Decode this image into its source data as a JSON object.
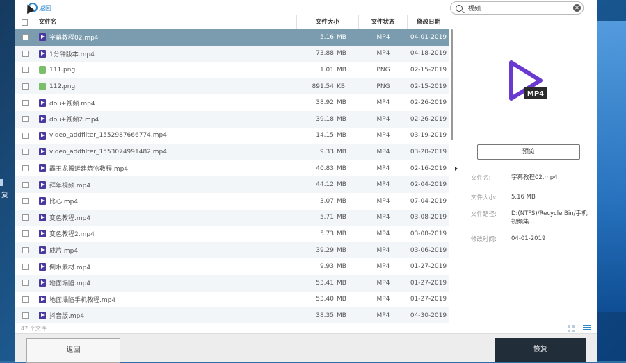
{
  "desktop": {
    "left_label": "复"
  },
  "header": {
    "back_link": "返回",
    "search": {
      "value": "视频"
    }
  },
  "table": {
    "columns": {
      "name": "文件名",
      "size": "文件大小",
      "status": "文件状态",
      "date": "修改日期"
    },
    "rows": [
      {
        "name": "字幕教程02.mp4",
        "size": "5.16",
        "unit": "MB",
        "status": "MP4",
        "date": "04-01-2019",
        "type": "mp4",
        "selected": true
      },
      {
        "name": "1分钟版本.mp4",
        "size": "73.88",
        "unit": "MB",
        "status": "MP4",
        "date": "04-18-2019",
        "type": "mp4"
      },
      {
        "name": "111.png",
        "size": "1.01",
        "unit": "MB",
        "status": "PNG",
        "date": "02-15-2019",
        "type": "png"
      },
      {
        "name": "112.png",
        "size": "891.54",
        "unit": "KB",
        "status": "PNG",
        "date": "02-15-2019",
        "type": "png"
      },
      {
        "name": "dou+视频.mp4",
        "size": "38.92",
        "unit": "MB",
        "status": "MP4",
        "date": "02-26-2019",
        "type": "mp4"
      },
      {
        "name": "dou+视频2.mp4",
        "size": "39.18",
        "unit": "MB",
        "status": "MP4",
        "date": "02-26-2019",
        "type": "mp4"
      },
      {
        "name": "video_addfilter_1552987666774.mp4",
        "size": "14.15",
        "unit": "MB",
        "status": "MP4",
        "date": "03-19-2019",
        "type": "mp4"
      },
      {
        "name": "video_addfilter_1553074991482.mp4",
        "size": "9.33",
        "unit": "MB",
        "status": "MP4",
        "date": "03-20-2019",
        "type": "mp4"
      },
      {
        "name": "霸王龙搬运建筑物教程.mp4",
        "size": "40.83",
        "unit": "MB",
        "status": "MP4",
        "date": "02-16-2019",
        "type": "mp4"
      },
      {
        "name": "拜年视频.mp4",
        "size": "44.12",
        "unit": "MB",
        "status": "MP4",
        "date": "02-04-2019",
        "type": "mp4"
      },
      {
        "name": "比心.mp4",
        "size": "3.07",
        "unit": "MB",
        "status": "MP4",
        "date": "07-04-2019",
        "type": "mp4"
      },
      {
        "name": "变色教程.mp4",
        "size": "5.71",
        "unit": "MB",
        "status": "MP4",
        "date": "03-08-2019",
        "type": "mp4"
      },
      {
        "name": "变色教程2.mp4",
        "size": "5.73",
        "unit": "MB",
        "status": "MP4",
        "date": "03-08-2019",
        "type": "mp4"
      },
      {
        "name": "成片.mp4",
        "size": "39.29",
        "unit": "MB",
        "status": "MP4",
        "date": "03-06-2019",
        "type": "mp4"
      },
      {
        "name": "倒水素材.mp4",
        "size": "9.93",
        "unit": "MB",
        "status": "MP4",
        "date": "01-27-2019",
        "type": "mp4"
      },
      {
        "name": "地面塌陷.mp4",
        "size": "53.41",
        "unit": "MB",
        "status": "MP4",
        "date": "01-27-2019",
        "type": "mp4"
      },
      {
        "name": "地面塌陷手机教程.mp4",
        "size": "53.40",
        "unit": "MB",
        "status": "MP4",
        "date": "01-27-2019",
        "type": "mp4"
      },
      {
        "name": "抖音版.mp4",
        "size": "38.35",
        "unit": "MB",
        "status": "MP4",
        "date": "04-30-2019",
        "type": "mp4"
      }
    ],
    "file_count": "47 个文件"
  },
  "preview": {
    "icon_badge": "MP4",
    "button": "预览",
    "labels": {
      "name": "文件名:",
      "size": "文件大小:",
      "path": "文件路径:",
      "date": "修改时间:"
    },
    "values": {
      "name": "字幕教程02.mp4",
      "size": "5.16  MB",
      "path": "D:(NTFS)/Recycle Bin/手机视频集...",
      "date": "04-01-2019"
    }
  },
  "footer": {
    "back_button": "返回",
    "recover_button": "恢复"
  },
  "colors": {
    "selected_row": "#7a9cae",
    "accent": "#2a86c9",
    "recover_button": "#222d3a",
    "mp4_icon": "#4a3aa0"
  }
}
